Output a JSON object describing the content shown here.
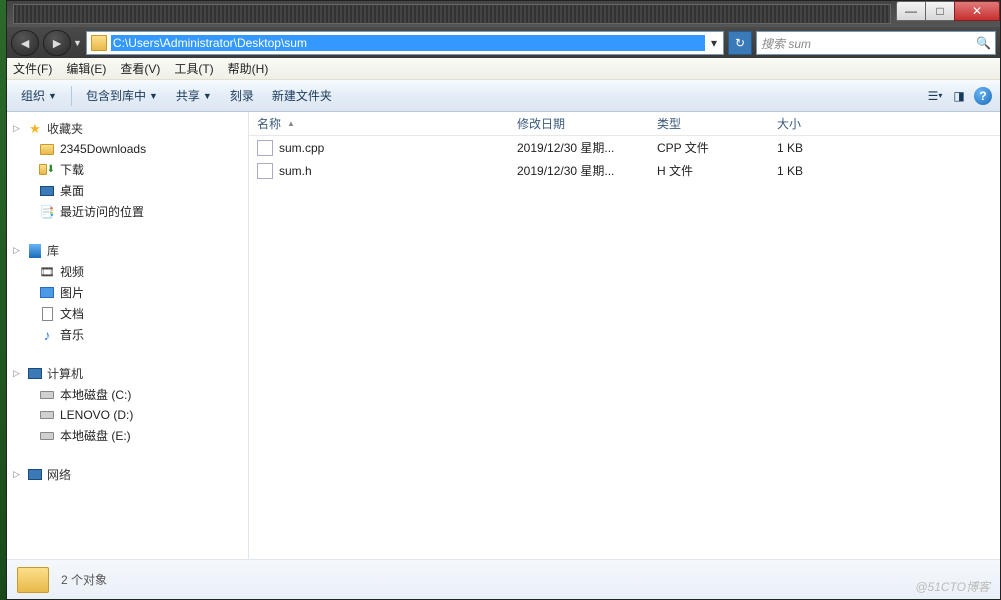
{
  "title_buttons": {
    "min": "—",
    "max": "□",
    "close": "✕"
  },
  "address": "C:\\Users\\Administrator\\Desktop\\sum",
  "search_placeholder": "搜索 sum",
  "menu": [
    "文件(F)",
    "编辑(E)",
    "查看(V)",
    "工具(T)",
    "帮助(H)"
  ],
  "toolbar": {
    "organize": "组织",
    "include": "包含到库中",
    "share": "共享",
    "burn": "刻录",
    "new_folder": "新建文件夹"
  },
  "sidebar": {
    "favorites": {
      "label": "收藏夹",
      "items": [
        "2345Downloads",
        "下载",
        "桌面",
        "最近访问的位置"
      ]
    },
    "libraries": {
      "label": "库",
      "items": [
        "视频",
        "图片",
        "文档",
        "音乐"
      ]
    },
    "computer": {
      "label": "计算机",
      "items": [
        "本地磁盘 (C:)",
        "LENOVO (D:)",
        "本地磁盘 (E:)"
      ]
    },
    "network": {
      "label": "网络"
    }
  },
  "columns": {
    "name": "名称",
    "date": "修改日期",
    "type": "类型",
    "size": "大小"
  },
  "files": [
    {
      "name": "sum.cpp",
      "date": "2019/12/30 星期...",
      "type": "CPP 文件",
      "size": "1 KB"
    },
    {
      "name": "sum.h",
      "date": "2019/12/30 星期...",
      "type": "H 文件",
      "size": "1 KB"
    }
  ],
  "status": "2 个对象",
  "watermark": "@51CTO博客"
}
